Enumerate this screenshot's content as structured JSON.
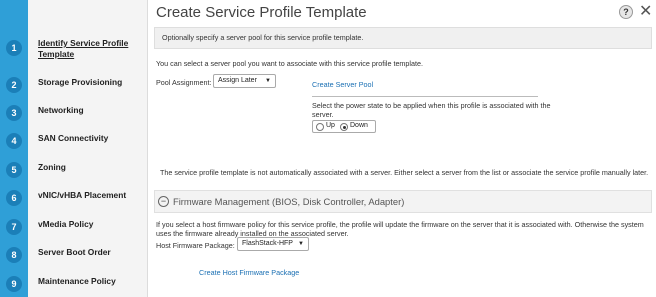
{
  "sidebar": {
    "steps": [
      {
        "number": "1",
        "label": "Identify Service Profile Template"
      },
      {
        "number": "2",
        "label": "Storage Provisioning"
      },
      {
        "number": "3",
        "label": "Networking"
      },
      {
        "number": "4",
        "label": "SAN Connectivity"
      },
      {
        "number": "5",
        "label": "Zoning"
      },
      {
        "number": "6",
        "label": "vNIC/vHBA Placement"
      },
      {
        "number": "7",
        "label": "vMedia Policy"
      },
      {
        "number": "8",
        "label": "Server Boot Order"
      },
      {
        "number": "9",
        "label": "Maintenance Policy"
      }
    ],
    "active_step": "1"
  },
  "dialog": {
    "title": "Create Service Profile Template",
    "help_label": "?",
    "close_label": "✕",
    "info": "Optionally specify a server pool for this service profile template."
  },
  "pool": {
    "intro": "You can select a server pool you want to associate with this service profile template.",
    "label": "Pool Assignment:",
    "value": "Assign Later",
    "create_link": "Create Server Pool",
    "power_text": "Select the power state to be applied when this profile is associated with the server.",
    "power_up": "Up",
    "power_down": "Down",
    "power_selected": "Down",
    "note": "The service profile template is not automatically associated with a server. Either select a server from the list or associate the service profile manually later."
  },
  "firmware": {
    "section_title": "Firmware Management (BIOS, Disk Controller, Adapter)",
    "collapse_icon": "minus-circle-icon",
    "description": "If you select a host firmware policy for this service profile, the profile will update the firmware on the server that it is associated with. Otherwise the system uses the firmware already installed on the associated server.",
    "package_label": "Host Firmware Package:",
    "package_value": "FlashStack-HFP",
    "create_link": "Create Host Firmware Package"
  },
  "colors": {
    "rail": "#2f9fd7",
    "step_circle": "#1b7fb8",
    "link": "#1a6fb3"
  }
}
